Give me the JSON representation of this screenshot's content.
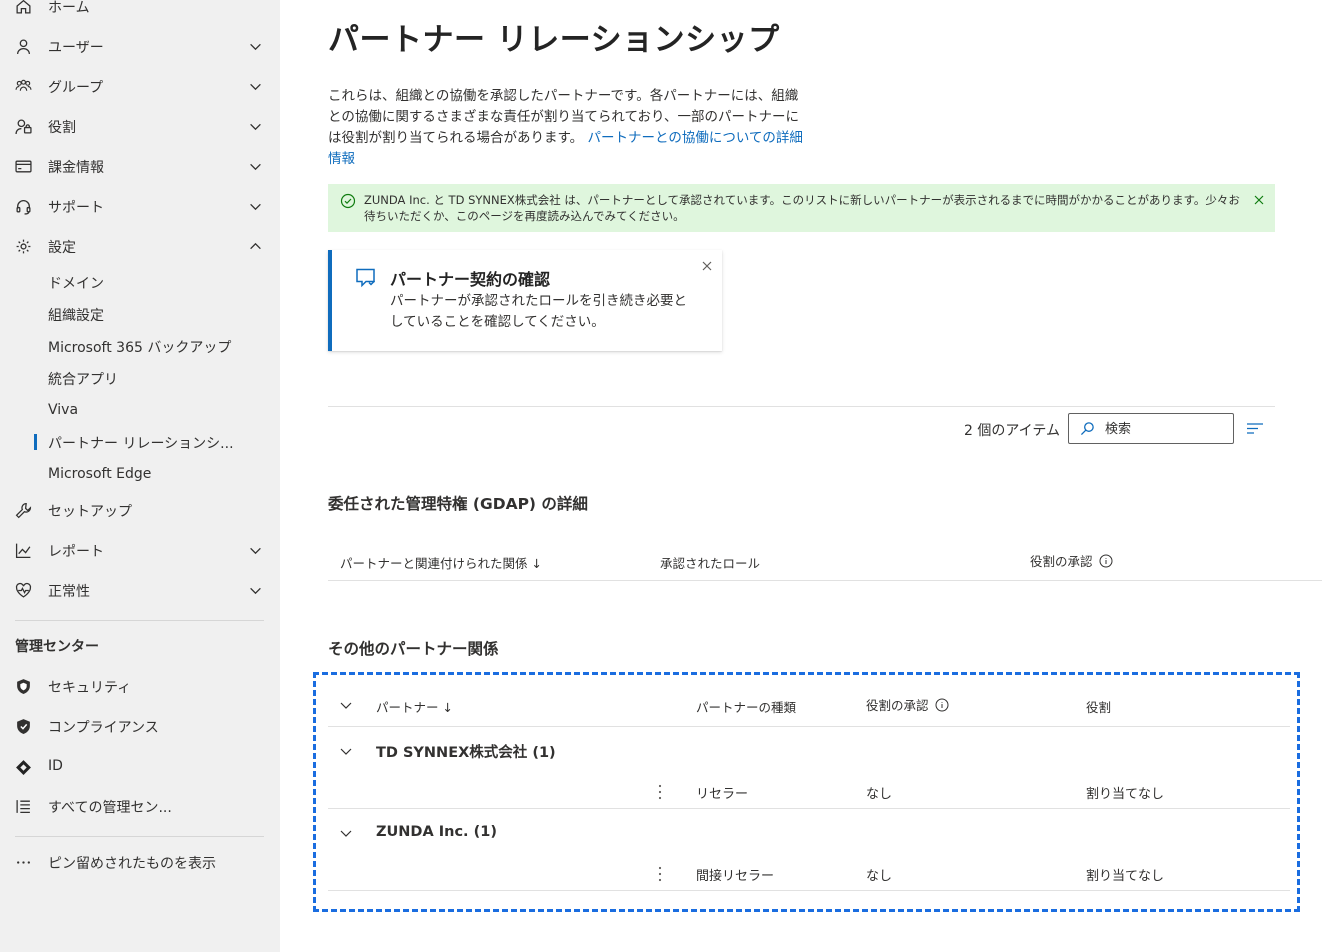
{
  "sidebar": {
    "items": [
      {
        "label": "ホーム",
        "icon": "home-icon"
      },
      {
        "label": "ユーザー",
        "icon": "user-icon"
      },
      {
        "label": "グループ",
        "icon": "group-icon"
      },
      {
        "label": "役割",
        "icon": "role-icon"
      },
      {
        "label": "課金情報",
        "icon": "billing-icon"
      },
      {
        "label": "サポート",
        "icon": "headset-icon"
      },
      {
        "label": "設定",
        "icon": "gear-icon"
      }
    ],
    "settings_sub": [
      {
        "label": "ドメイン"
      },
      {
        "label": "組織設定"
      },
      {
        "label": "Microsoft 365 バックアップ"
      },
      {
        "label": "統合アプリ"
      },
      {
        "label": "Viva"
      },
      {
        "label": "パートナー リレーションシ..."
      },
      {
        "label": "Microsoft Edge"
      }
    ],
    "items2": [
      {
        "label": "セットアップ",
        "icon": "wrench-icon"
      },
      {
        "label": "レポート",
        "icon": "chart-icon"
      },
      {
        "label": "正常性",
        "icon": "heart-icon"
      }
    ],
    "admin_heading": "管理センター",
    "admin_items": [
      {
        "label": "セキュリティ",
        "icon": "shield-icon"
      },
      {
        "label": "コンプライアンス",
        "icon": "compliance-icon"
      },
      {
        "label": "ID",
        "icon": "identity-icon"
      },
      {
        "label": "すべての管理セン...",
        "icon": "list-icon"
      }
    ],
    "pinned_label": "ピン留めされたものを表示"
  },
  "main": {
    "title": "パートナー リレーションシップ",
    "description": "これらは、組織との協働を承認したパートナーです。各パートナーには、組織との協働に関するさまざまな責任が割り当てられており、一部のパートナーには役割が割り当てられる場合があります。",
    "description_link": "パートナーとの協働についての詳細情報",
    "success_message": "ZUNDA Inc. と TD SYNNEX株式会社 は、パートナーとして承認されています。このリストに新しいパートナーが表示されるまでに時間がかかることがあります。少々お待ちいただくか、このページを再度読み込んでみてください。",
    "card": {
      "title": "パートナー契約の確認",
      "body": "パートナーが承認されたロールを引き続き必要としていることを確認してください。"
    },
    "items_count": "2 個のアイテム",
    "search_placeholder": "検索",
    "gdap": {
      "title": "委任された管理特権 (GDAP) の詳細",
      "columns": [
        "パートナーと関連付けられた関係 ↓",
        "承認されたロール",
        "役割の承認"
      ]
    },
    "other": {
      "title": "その他のパートナー関係",
      "columns": [
        "パートナー ↓",
        "パートナーの種類",
        "役割の承認",
        "役割"
      ],
      "groups": [
        {
          "name": "TD SYNNEX株式会社 (1)",
          "type": "リセラー",
          "approval": "なし",
          "role": "割り当てなし"
        },
        {
          "name": "ZUNDA Inc. (1)",
          "type": "間接リセラー",
          "approval": "なし",
          "role": "割り当てなし"
        }
      ]
    }
  },
  "colors": {
    "accent": "#0f6cbd",
    "success_bg": "#dff6dd",
    "highlight_dashed": "#1a6de0"
  }
}
